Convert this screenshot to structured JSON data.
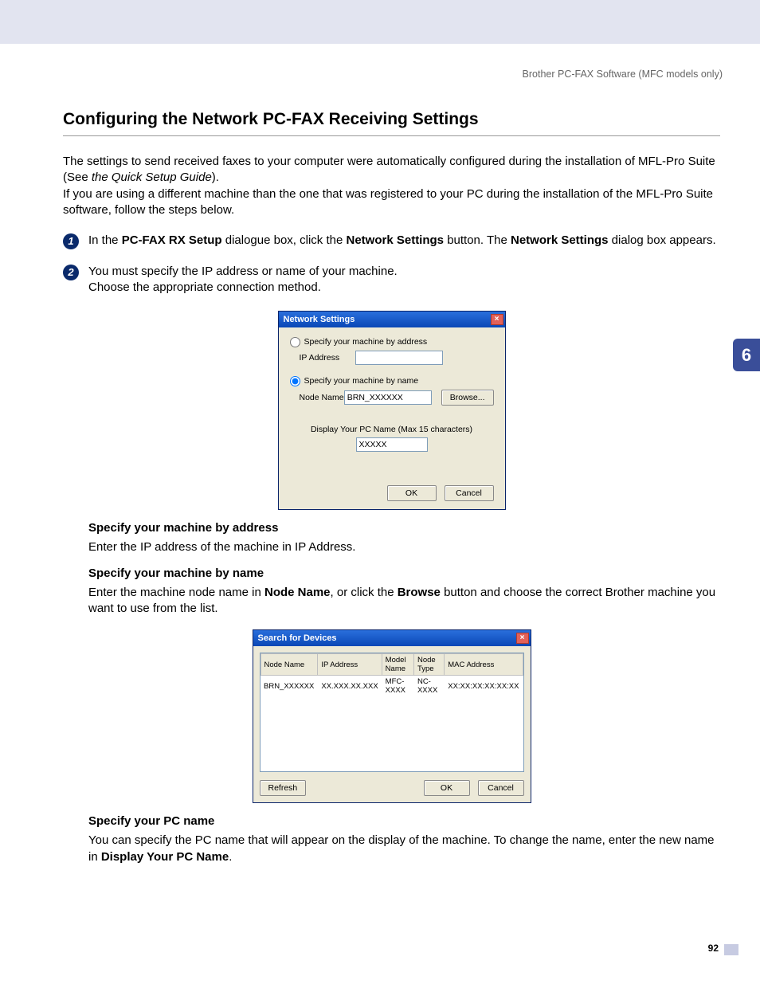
{
  "header": "Brother PC-FAX Software (MFC models only)",
  "section_title": "Configuring the Network PC-FAX Receiving Settings",
  "intro": {
    "p1a": "The settings to send received faxes to your computer were automatically configured during the installation of MFL-Pro Suite (See ",
    "p1b": "the Quick Setup Guide",
    "p1c": ").",
    "p2": "If you are using a different machine than the one that was registered to your PC during the installation of the MFL-Pro Suite software, follow the steps below."
  },
  "step1": {
    "a": "In the ",
    "b": "PC-FAX RX Setup",
    "c": " dialogue box, click the ",
    "d": "Network Settings",
    "e": " button. The ",
    "f": "Network Settings",
    "g": " dialog box appears."
  },
  "step2": {
    "l1": "You must specify the IP address or name of your machine.",
    "l2": "Choose the appropriate connection method."
  },
  "dialog1": {
    "title": "Network Settings",
    "radio_addr": "Specify your machine by address",
    "ip_label": "IP Address",
    "ip_value": "",
    "radio_name": "Specify your machine by name",
    "node_label": "Node Name",
    "node_value": "BRN_XXXXXX",
    "browse": "Browse...",
    "display_label": "Display Your PC Name (Max 15 characters)",
    "display_value": "XXXXX",
    "ok": "OK",
    "cancel": "Cancel"
  },
  "spec_addr": {
    "hd": "Specify your machine by address",
    "body": "Enter the IP address of the machine in IP Address."
  },
  "spec_name": {
    "hd": "Specify your machine by name",
    "b1": "Enter the machine node name in ",
    "b2": "Node Name",
    "b3": ", or click the ",
    "b4": "Browse",
    "b5": " button and choose the correct Brother machine you want to use from the list."
  },
  "dialog2": {
    "title": "Search for Devices",
    "cols": [
      "Node Name",
      "IP Address",
      "Model Name",
      "Node Type",
      "MAC Address"
    ],
    "rows": [
      [
        "BRN_XXXXXX",
        "XX.XXX.XX.XXX",
        "MFC-XXXX",
        "NC-XXXX",
        "XX:XX:XX:XX:XX:XX"
      ]
    ],
    "refresh": "Refresh",
    "ok": "OK",
    "cancel": "Cancel"
  },
  "spec_pc": {
    "hd": "Specify your PC name",
    "b1": "You can specify the PC name that will appear on the display of the machine. To change the name, enter the new name in ",
    "b2": "Display Your PC Name",
    "b3": "."
  },
  "chapter": "6",
  "page": "92"
}
